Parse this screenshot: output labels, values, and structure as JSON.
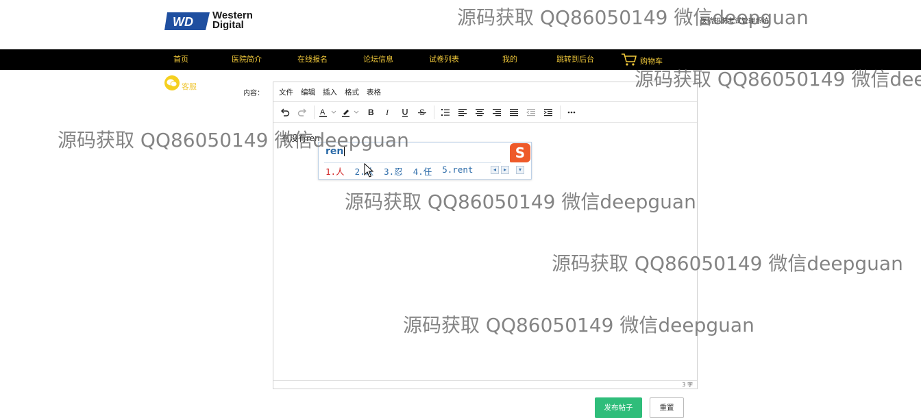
{
  "header": {
    "logo_line1": "Western",
    "logo_line2": "Digital",
    "logo_mark": "WD",
    "site_title": "医院招聘考试管理系统"
  },
  "nav": {
    "items": [
      "首页",
      "医院简介",
      "在线报名",
      "论坛信息",
      "试卷列表",
      "我的",
      "跳转到后台"
    ],
    "cart_label": "购物车",
    "cart_icon": "cart-icon",
    "text_color": "#f0c83a"
  },
  "service": {
    "label": "客服",
    "icon": "wechat-icon"
  },
  "form": {
    "content_label": "内容："
  },
  "editor": {
    "menus": [
      "文件",
      "编辑",
      "插入",
      "格式",
      "表格"
    ],
    "toolbar_icons": [
      "undo-icon",
      "redo-icon",
      "font-color-icon",
      "highlight-icon",
      "bold-icon",
      "italic-icon",
      "underline-icon",
      "strikethrough-icon",
      "list-icon",
      "align-left-icon",
      "align-center-icon",
      "align-right-icon",
      "align-justify-icon",
      "outdent-icon",
      "indent-icon",
      "more-icon"
    ],
    "body_text": "有没有ren",
    "word_count": "3 字"
  },
  "ime": {
    "composition": "ren",
    "candidates": [
      "1.人",
      "2.认",
      "3.忍",
      "4.任",
      "5.rent"
    ],
    "logo": "S"
  },
  "buttons": {
    "publish": "发布帖子",
    "reset": "重置",
    "publish_color": "#2fbd7a"
  },
  "watermark": {
    "text": "源码获取 QQ86050149 微信deepguan"
  }
}
